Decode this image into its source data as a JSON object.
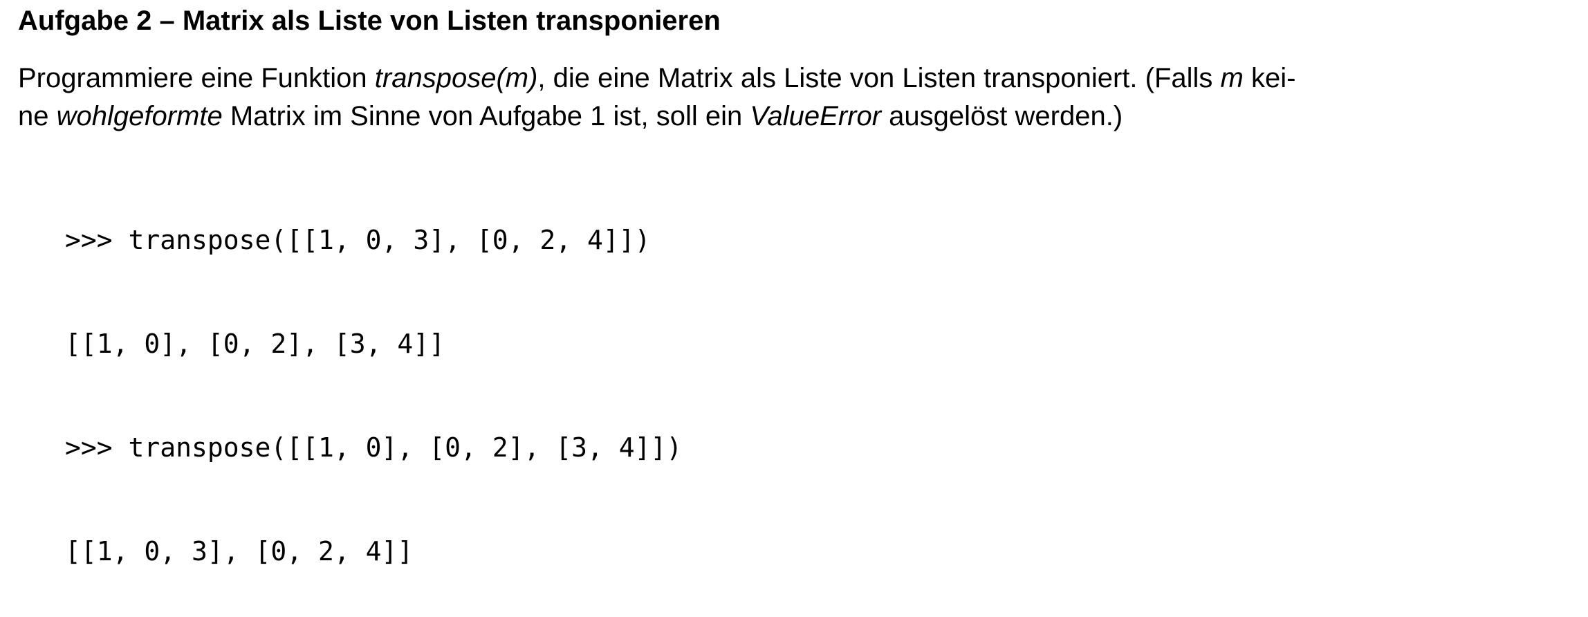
{
  "task": {
    "title": "Aufgabe 2 – Matrix als Liste von Listen transponieren",
    "paragraph": {
      "line1": [
        {
          "text": "Programmiere eine Funktion ",
          "italic": false
        },
        {
          "text": "transpose(m)",
          "italic": true
        },
        {
          "text": ", die eine Matrix als Liste von Listen transponiert. (Falls ",
          "italic": false
        },
        {
          "text": "m",
          "italic": true
        },
        {
          "text": " kei-",
          "italic": false
        }
      ],
      "line2": [
        {
          "text": "ne ",
          "italic": false
        },
        {
          "text": "wohlgeformte",
          "italic": true
        },
        {
          "text": " Matrix im Sinne von Aufgabe 1 ist, soll ein ",
          "italic": false
        },
        {
          "text": "ValueError",
          "italic": true
        },
        {
          "text": " ausgelöst werden.)",
          "italic": false
        }
      ]
    },
    "code_example": [
      ">>> transpose([[1, 0, 3], [0, 2, 4]])",
      "[[1, 0], [0, 2], [3, 4]]",
      ">>> transpose([[1, 0], [0, 2], [3, 4]])",
      "[[1, 0, 3], [0, 2, 4]]"
    ]
  }
}
